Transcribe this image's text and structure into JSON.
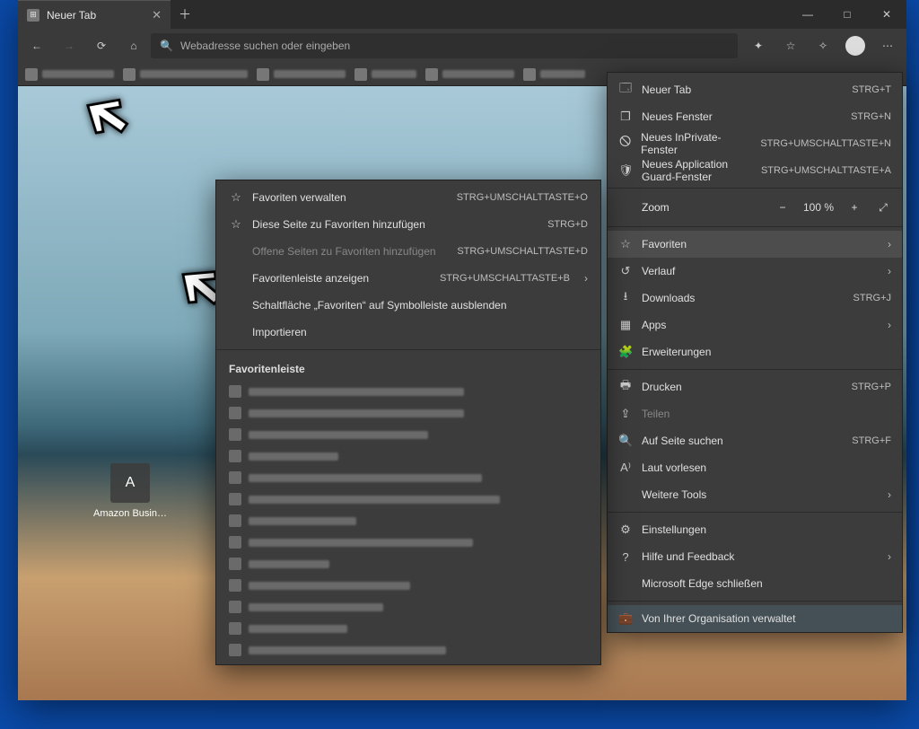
{
  "tab": {
    "title": "Neuer Tab"
  },
  "omnibar": {
    "placeholder": "Webadresse suchen oder eingeben"
  },
  "quicklink": {
    "letter": "A",
    "label": "Amazon Busin…"
  },
  "zoom": {
    "label": "Zoom",
    "value": "100 %"
  },
  "menu": {
    "newtab": {
      "label": "Neuer Tab",
      "shortcut": "STRG+T"
    },
    "newwin": {
      "label": "Neues Fenster",
      "shortcut": "STRG+N"
    },
    "inprivate": {
      "label": "Neues InPrivate-Fenster",
      "shortcut": "STRG+UMSCHALTTASTE+N"
    },
    "appguard": {
      "label": "Neues Application Guard-Fenster",
      "shortcut": "STRG+UMSCHALTTASTE+A"
    },
    "favorites": {
      "label": "Favoriten"
    },
    "history": {
      "label": "Verlauf"
    },
    "downloads": {
      "label": "Downloads",
      "shortcut": "STRG+J"
    },
    "apps": {
      "label": "Apps"
    },
    "extensions": {
      "label": "Erweiterungen"
    },
    "print": {
      "label": "Drucken",
      "shortcut": "STRG+P"
    },
    "share": {
      "label": "Teilen"
    },
    "find": {
      "label": "Auf Seite suchen",
      "shortcut": "STRG+F"
    },
    "readaloud": {
      "label": "Laut vorlesen"
    },
    "moretools": {
      "label": "Weitere Tools"
    },
    "settings": {
      "label": "Einstellungen"
    },
    "help": {
      "label": "Hilfe und Feedback"
    },
    "close": {
      "label": "Microsoft Edge schließen"
    },
    "managed": {
      "label": "Von Ihrer Organisation verwaltet"
    }
  },
  "favmenu": {
    "manage": {
      "label": "Favoriten verwalten",
      "shortcut": "STRG+UMSCHALTTASTE+O"
    },
    "addpage": {
      "label": "Diese Seite zu Favoriten hinzufügen",
      "shortcut": "STRG+D"
    },
    "addopen": {
      "label": "Offene Seiten zu Favoriten hinzufügen",
      "shortcut": "STRG+UMSCHALTTASTE+D"
    },
    "showbar": {
      "label": "Favoritenleiste anzeigen",
      "shortcut": "STRG+UMSCHALTTASTE+B"
    },
    "hidebtn": {
      "label": "Schaltfläche „Favoriten“ auf Symbolleiste ausblenden"
    },
    "import": {
      "label": "Importieren"
    },
    "barheader": "Favoritenleiste"
  }
}
